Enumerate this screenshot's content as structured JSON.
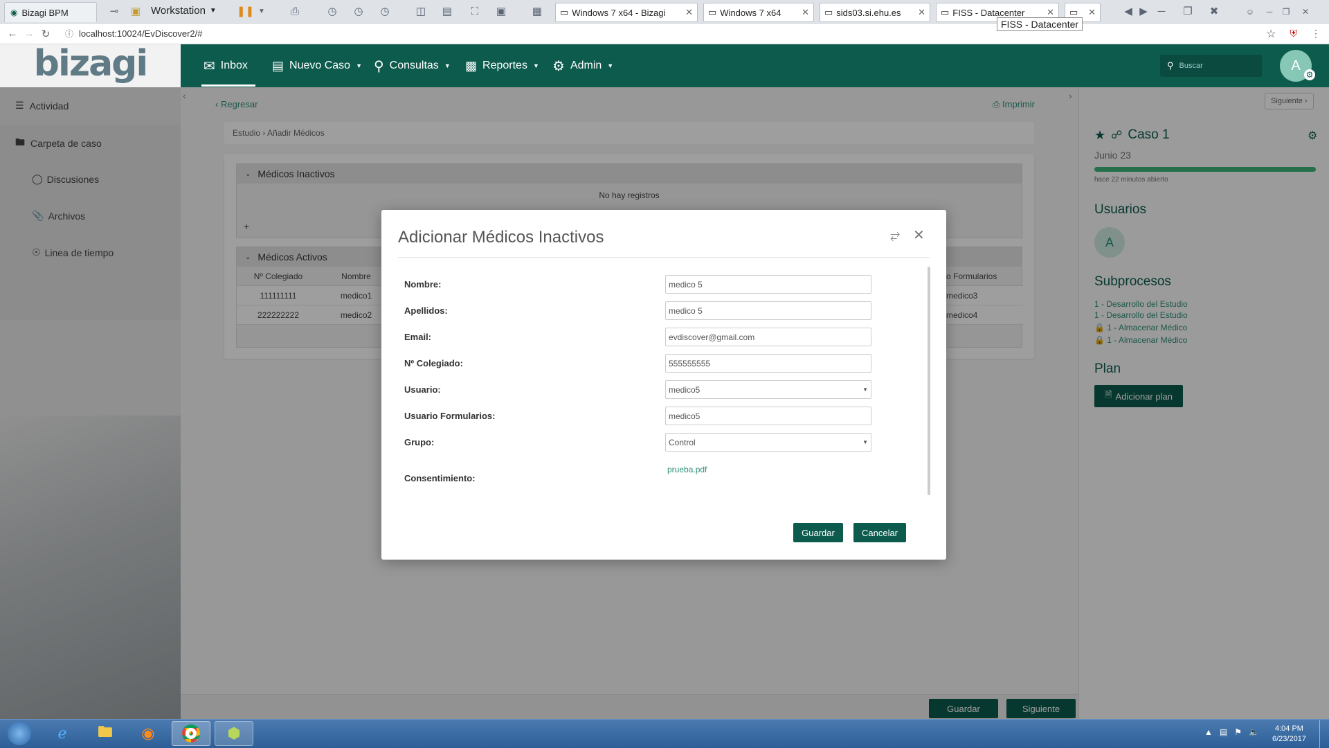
{
  "browser": {
    "tab_title": "Bizagi BPM",
    "workstation_label": "Workstation",
    "vm_tabs": [
      "Windows 7 x64 - Bizagi",
      "Windows 7 x64",
      "sids03.si.ehu.es",
      "FISS - Datacenter"
    ],
    "tooltip": "FISS - Datacenter",
    "url": "localhost:10024/EvDiscover2/#"
  },
  "app": {
    "logo": "bizagi",
    "menu": {
      "inbox": "Inbox",
      "nuevo_caso": "Nuevo Caso",
      "consultas": "Consultas",
      "reportes": "Reportes",
      "admin": "Admin"
    },
    "search_placeholder": "Buscar",
    "avatar_letter": "A"
  },
  "sidebar": {
    "items": [
      {
        "label": "Actividad",
        "icon": "list-icon"
      },
      {
        "label": "Carpeta de caso",
        "icon": "folder-icon"
      },
      {
        "label": "Discusiones",
        "icon": "chat-icon"
      },
      {
        "label": "Archivos",
        "icon": "paperclip-icon"
      },
      {
        "label": "Linea de tiempo",
        "icon": "timeline-icon"
      }
    ]
  },
  "main": {
    "back_label": "Regresar",
    "print_label": "Imprimir",
    "breadcrumb": "Estudio › Añadir Médicos",
    "inactivos": {
      "title": "Médicos Inactivos",
      "empty": "No hay registros",
      "add": "+"
    },
    "activos": {
      "title": "Médicos Activos",
      "columns": [
        "Nº Colegiado",
        "Nombre",
        "o Formularios"
      ],
      "rows": [
        [
          "111111111",
          "medico1",
          "medico3"
        ],
        [
          "222222222",
          "medico2",
          "medico4"
        ]
      ]
    }
  },
  "right_panel": {
    "next_label": "Siguiente ›",
    "case_title": "Caso 1",
    "date": "Junio 23",
    "progress": 1.0,
    "opened": "hace 22 minutos abierto",
    "users_title": "Usuarios",
    "user_letter": "A",
    "subprocesos_title": "Subprocesos",
    "subprocesos": [
      "1 - Desarrollo del Estudio",
      "1 - Desarrollo del Estudio",
      "1 - Almacenar Médico",
      "1 - Almacenar Médico"
    ],
    "plan_title": "Plan",
    "plan_button": "Adicionar plan"
  },
  "dialog": {
    "title": "Adicionar Médicos Inactivos",
    "fields": {
      "nombre": {
        "label": "Nombre:",
        "value": "medico 5"
      },
      "apellidos": {
        "label": "Apellidos:",
        "value": "medico 5"
      },
      "email": {
        "label": "Email:",
        "value": "evdiscover@gmail.com"
      },
      "colegiado": {
        "label": "Nº Colegiado:",
        "value": "555555555"
      },
      "usuario": {
        "label": "Usuario:",
        "value": "medico5"
      },
      "usuario_formularios": {
        "label": "Usuario Formularios:",
        "value": "medico5"
      },
      "grupo": {
        "label": "Grupo:",
        "value": "Control"
      },
      "consentimiento": {
        "label": "Consentimiento:",
        "value": "prueba.pdf"
      }
    },
    "save": "Guardar",
    "cancel": "Cancelar"
  },
  "footer": {
    "save": "Guardar",
    "next": "Siguiente"
  },
  "taskbar": {
    "time": "4:04 PM",
    "date": "6/23/2017"
  },
  "colors": {
    "brand_green": "#0c5b4d",
    "progress_green": "#3db37a",
    "link_green": "#2d8f78"
  }
}
